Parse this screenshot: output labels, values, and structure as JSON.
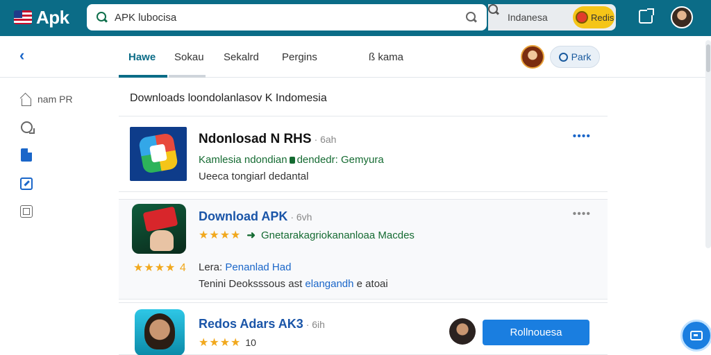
{
  "app": {
    "name": "Apk"
  },
  "topbar": {
    "search_value": "APK lubocisa",
    "secondary_search": "Indanesa",
    "badge_label": "Redis"
  },
  "subnav": {
    "tabs": [
      {
        "label": "Hawe",
        "active": true
      },
      {
        "label": "Sokau",
        "active": false
      },
      {
        "label": "Sekalrd",
        "active": false
      },
      {
        "label": "Pergins",
        "active": false
      },
      {
        "label": "ß kama",
        "active": false
      }
    ],
    "park_label": "Park"
  },
  "sidebar": {
    "items": [
      {
        "label": "nam PR",
        "icon": "home-icon"
      },
      {
        "label": "",
        "icon": "settings-icon"
      },
      {
        "label": "",
        "icon": "document-icon"
      },
      {
        "label": "",
        "icon": "edit-icon"
      },
      {
        "label": "",
        "icon": "box-icon"
      }
    ]
  },
  "main": {
    "heading": "Downloads loondolanlasov K Indomesia",
    "cards": [
      {
        "title": "Ndonlosad N RHS",
        "time": "· 6ah",
        "line1a": "Kamlesia ndondian",
        "line1b": "dendedr: Gemyura",
        "line2": "Ueeca tongiarl dedantal",
        "more": "••••"
      },
      {
        "title": "Download APK",
        "time": "· 6vh",
        "stars": "★★★★",
        "sub_stars": "★★★★ 4",
        "line1": "Gnetarakagriokananloaa Macdes",
        "line3a": "Lera:",
        "line3b": "Penanlad Had",
        "line4a": "Tenini Deoksssous ast",
        "line4b": "elangandh",
        "line4c": "e atoai",
        "more": "••••"
      },
      {
        "title": "Redos Adars AK3",
        "time": "· 6ih",
        "stars": "★★★★",
        "rating": "10",
        "cta": "Rollnouesa"
      }
    ]
  },
  "colors": {
    "topbar": "#0b6c87",
    "accent_blue": "#1a66c9",
    "green_text": "#156b32",
    "star": "#f1a81d"
  }
}
